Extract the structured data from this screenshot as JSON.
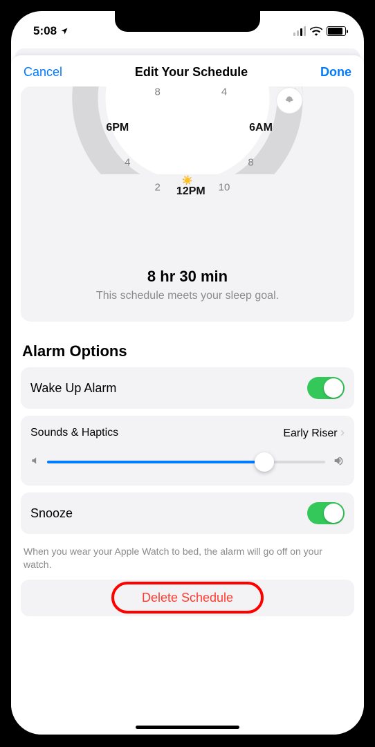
{
  "status": {
    "time": "5:08"
  },
  "nav": {
    "cancel": "Cancel",
    "title": "Edit Your Schedule",
    "done": "Done"
  },
  "dial": {
    "labels": {
      "h8a": "8",
      "h4a": "4",
      "h6pm": "6PM",
      "h6am": "6AM",
      "h4b": "4",
      "h8b": "8",
      "h2": "2",
      "h12pm": "12PM",
      "h10": "10"
    }
  },
  "summary": {
    "duration": "8 hr 30 min",
    "goal": "This schedule meets your sleep goal."
  },
  "alarm": {
    "section_title": "Alarm Options",
    "wake_label": "Wake Up Alarm",
    "wake_on": true,
    "sounds_label": "Sounds & Haptics",
    "sounds_value": "Early Riser",
    "volume_percent": 78,
    "snooze_label": "Snooze",
    "snooze_on": true,
    "footnote": "When you wear your Apple Watch to bed, the alarm will go off on your watch."
  },
  "delete": {
    "label": "Delete Schedule"
  }
}
